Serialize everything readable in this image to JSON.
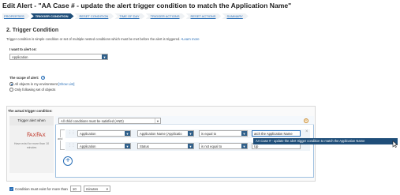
{
  "page": {
    "title": "Edit Alert - \"AA Case # - update the alert trigger condition to match the Application Name\""
  },
  "steps": [
    {
      "label": "PROPERTIES"
    },
    {
      "label": "TRIGGER CONDITION"
    },
    {
      "label": "RESET CONDITION"
    },
    {
      "label": "TIME OF DAY"
    },
    {
      "label": "TRIGGER ACTIONS"
    },
    {
      "label": "RESET ACTIONS"
    },
    {
      "label": "SUMMARY"
    }
  ],
  "section": {
    "title": "2. Trigger Condition",
    "description": "Trigger condition is simple condition or set of multiple nested conditions which must be met before the alert is triggered.",
    "learn_more": "•Learn more"
  },
  "alert_on": {
    "label": "I want to alert on:",
    "value": "Application"
  },
  "scope": {
    "label": "The scope of alert:",
    "option_all": "All objects in my environment",
    "show_list": "[Show List]",
    "option_following": "Only following set of objects"
  },
  "trigger": {
    "heading": "The actual trigger condition:",
    "alert_when": "Trigger alert when",
    "group_logic": "All child conditions must be satisfied (AND)",
    "and_label": "and",
    "must_exist_text": "Have exist for more than 10 minutes",
    "rows": [
      {
        "object": "Application",
        "field": "Application Name (Applicatio",
        "operator": "is equal to",
        "value": "atch the Application Name"
      },
      {
        "object": "Application",
        "field": "Status",
        "operator": "is not equal to",
        "value": "Up"
      }
    ],
    "tooltip": "AA Case # - update the alert trigger condition to match the Application Name"
  },
  "bottom": {
    "checkbox_label": "Condition must exist for more than",
    "duration": "10",
    "unit": "minutes"
  },
  "icons": {
    "caret": "chevron-down-icon",
    "close": "close-icon",
    "add": "plus-icon",
    "help": "help-icon",
    "drag": "drag-handle-icon"
  },
  "colors": {
    "accent": "#1f4e79",
    "link": "#2a6fb7",
    "tally": "#c0392b"
  }
}
